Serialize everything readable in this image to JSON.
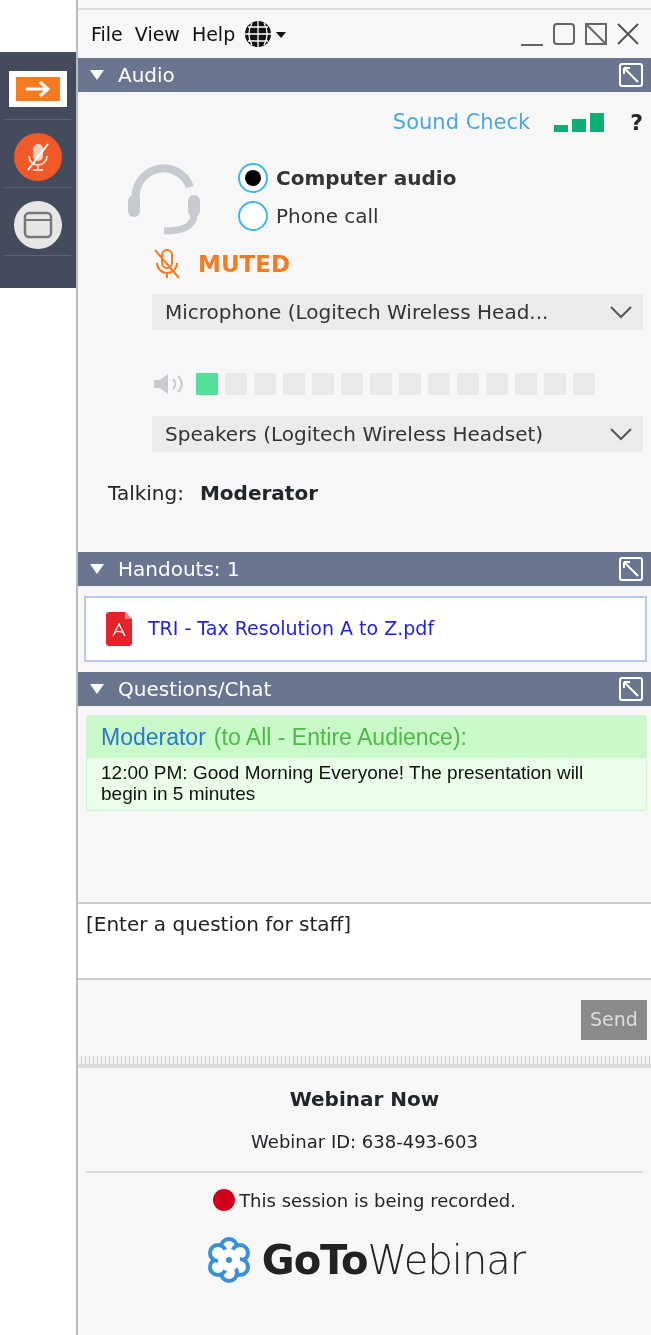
{
  "toolbar": [
    {
      "kind": "arrow",
      "selected": true
    },
    {
      "kind": "mic",
      "muted": true
    },
    {
      "kind": "window",
      "selected": false
    }
  ],
  "menu": [
    "File",
    "View",
    "Help"
  ],
  "audio": {
    "title": "Audio",
    "expanded": true,
    "sound_check": "Sound Check",
    "help": "?",
    "modes": [
      {
        "label": "Computer audio",
        "selected": true
      },
      {
        "label": "Phone call",
        "selected": false
      }
    ],
    "status": {
      "text": "MUTED",
      "muted": true
    },
    "microphone": "Microphone (Logitech  Wireless  Head...",
    "meter": {
      "level": 0.07
    },
    "speakers": "Speakers (Logitech Wireless Headset)",
    "talking_label": "Talking:",
    "talking_name": "Moderator"
  },
  "handouts": {
    "title": "Handouts: 1",
    "expanded": true,
    "files": [
      {
        "name": "TRI - Tax Resolution A to Z.pdf"
      }
    ]
  },
  "chat": {
    "title": "Questions/Chat",
    "expanded": true,
    "messages": [
      {
        "sender": "Moderator",
        "audience": "(to All - Entire Audience):",
        "text": "12:00 PM: Good Morning Everyone! The presentation will begin in 5 minutes"
      }
    ],
    "input": {
      "placeholder": "[Enter a question for staff]"
    },
    "send": {
      "label": "Send",
      "disabled": true
    }
  },
  "footer": {
    "title": "Webinar Now",
    "webinar_id": "Webinar ID: 638-493-603",
    "recording": "This session is being recorded.",
    "recording_on": true,
    "logo": "**GoTo**Webinar"
  }
}
